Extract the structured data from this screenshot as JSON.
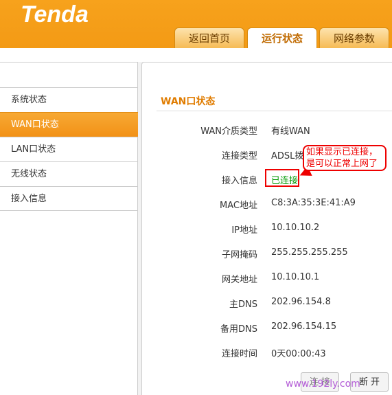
{
  "header": {
    "logo": "Tenda",
    "tabs": [
      {
        "label": "返回首页"
      },
      {
        "label": "运行状态"
      },
      {
        "label": "网络参数"
      }
    ]
  },
  "sidebar": {
    "items": [
      {
        "label": "系统状态"
      },
      {
        "label": "WAN口状态"
      },
      {
        "label": "LAN口状态"
      },
      {
        "label": "无线状态"
      },
      {
        "label": "接入信息"
      }
    ],
    "active_index": 1
  },
  "main": {
    "title": "WAN口状态",
    "fields": [
      {
        "label": "WAN介质类型",
        "value": "有线WAN"
      },
      {
        "label": "连接类型",
        "value": "ADSL拨号"
      },
      {
        "label": "接入信息",
        "value": "已连接"
      },
      {
        "label": "MAC地址",
        "value": "C8:3A:35:3E:41:A9"
      },
      {
        "label": "IP地址",
        "value": "10.10.10.2"
      },
      {
        "label": "子网掩码",
        "value": "255.255.255.255"
      },
      {
        "label": "网关地址",
        "value": "10.10.10.1"
      },
      {
        "label": "主DNS",
        "value": "202.96.154.8"
      },
      {
        "label": "备用DNS",
        "value": "202.96.154.15"
      },
      {
        "label": "连接时间",
        "value": "0天00:00:43"
      }
    ],
    "buttons": {
      "connect": "连 接",
      "disconnect": "断 开"
    }
  },
  "annotation": {
    "line1": "如果显示已连接，",
    "line2": "是可以正常上网了"
  },
  "watermark": "www.192ly.com",
  "colors": {
    "brand_orange": "#f39a15",
    "title_orange": "#e07c00",
    "connected_green": "#009900",
    "annotation_red": "#ee0000"
  }
}
